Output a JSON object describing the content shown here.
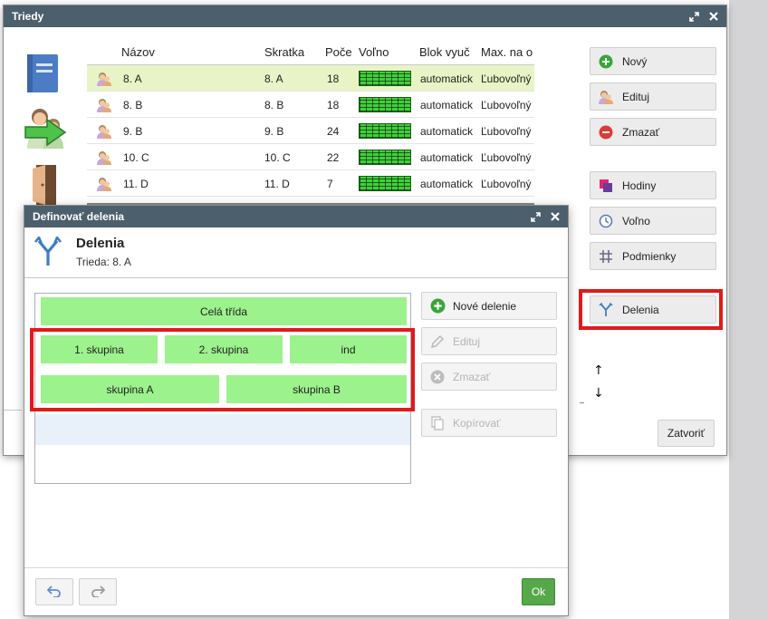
{
  "colors": {
    "titlebar": "#4c5f6c",
    "selected_row": "#e8f4c6",
    "tile": "#9cf28c",
    "ok": "#56a84a",
    "highlight": "#e01a1a"
  },
  "main_window": {
    "title": "Triedy",
    "columns": [
      "Názov",
      "Skratka",
      "Poče",
      "Voľno",
      "Blok vyuč",
      "Max. na o"
    ],
    "rows": [
      {
        "name": "8. A",
        "short": "8. A",
        "count": "18",
        "block": "automatick",
        "max": "Ľubovoľný",
        "selected": true
      },
      {
        "name": "8. B",
        "short": "8. B",
        "count": "18",
        "block": "automatick",
        "max": "Ľubovoľný"
      },
      {
        "name": "9. B",
        "short": "9. B",
        "count": "24",
        "block": "automatick",
        "max": "Ľubovoľný"
      },
      {
        "name": "10. C",
        "short": "10. C",
        "count": "22",
        "block": "automatick",
        "max": "Ľubovoľný"
      },
      {
        "name": "11. D",
        "short": "11. D",
        "count": "7",
        "block": "automatick",
        "max": "Ľubovoľný"
      }
    ],
    "buttons": {
      "new": "Nový",
      "edit": "Edituj",
      "delete": "Zmazať",
      "hours": "Hodiny",
      "free": "Voľno",
      "conditions": "Podmienky",
      "divisions": "Delenia",
      "up": "↑",
      "down": "↓",
      "close": "Zatvoriť"
    }
  },
  "dialog": {
    "title": "Definovať delenia",
    "heading": "Delenia",
    "subtitle": "Trieda: 8. A",
    "whole_class": "Celá třída",
    "division1": [
      "1. skupina",
      "2. skupina",
      "ind"
    ],
    "division2": [
      "skupina A",
      "skupina B"
    ],
    "buttons": {
      "new": "Nové delenie",
      "edit": "Edituj",
      "delete": "Zmazať",
      "copy": "Kopírovať",
      "ok": "Ok"
    }
  }
}
